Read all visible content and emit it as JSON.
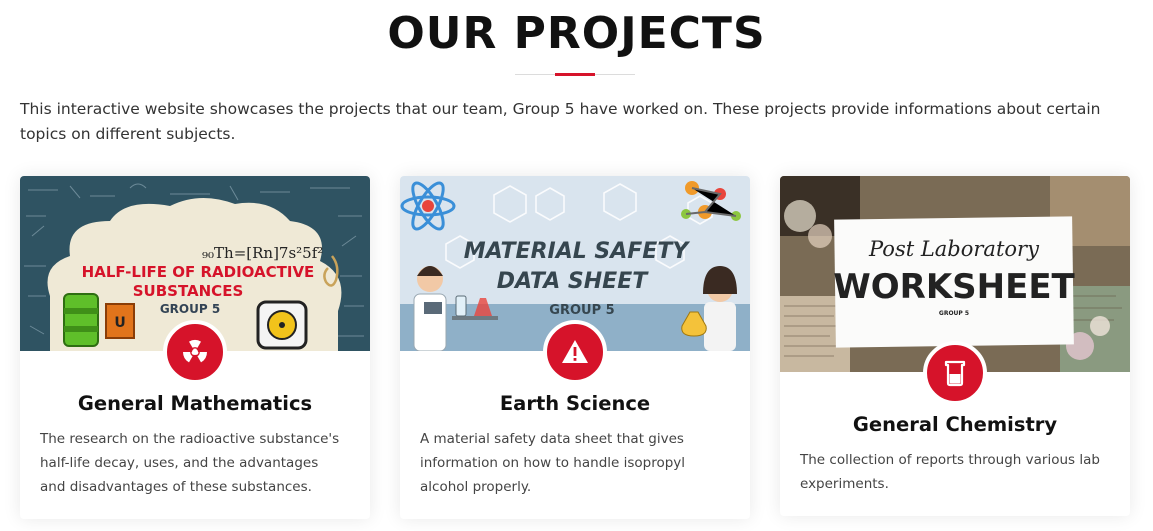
{
  "section": {
    "title": "OUR PROJECTS",
    "intro": "This interactive website showcases the projects that our team, Group 5 have worked on. These projects provide informations about certain topics on different subjects."
  },
  "colors": {
    "accent": "#d6132a",
    "title": "#111111",
    "text": "#444444"
  },
  "projects": [
    {
      "subject": "General Mathematics",
      "description": "The research on the radioactive substance's half-life decay, uses, and the advantages and disadvantages of these substances.",
      "icon": "radiation-icon",
      "thumbnail": {
        "title_line1": "HALF-LIFE OF RADIOACTIVE",
        "title_line2": "SUBSTANCES",
        "subtitle": "GROUP 5",
        "formula": "₉₀Th=[Rn]7s²5f²"
      }
    },
    {
      "subject": "Earth Science",
      "description": "A material safety data sheet that gives information on how to handle isopropyl alcohol properly.",
      "icon": "warning-icon",
      "thumbnail": {
        "title_line1": "MATERIAL SAFETY",
        "title_line2": "DATA SHEET",
        "subtitle": "GROUP 5"
      }
    },
    {
      "subject": "General Chemistry",
      "description": "The collection of reports through various lab experiments.",
      "icon": "beaker-icon",
      "thumbnail": {
        "title_line1": "Post Laboratory",
        "title_line2": "WORKSHEET",
        "subtitle": "GROUP 5"
      }
    }
  ]
}
